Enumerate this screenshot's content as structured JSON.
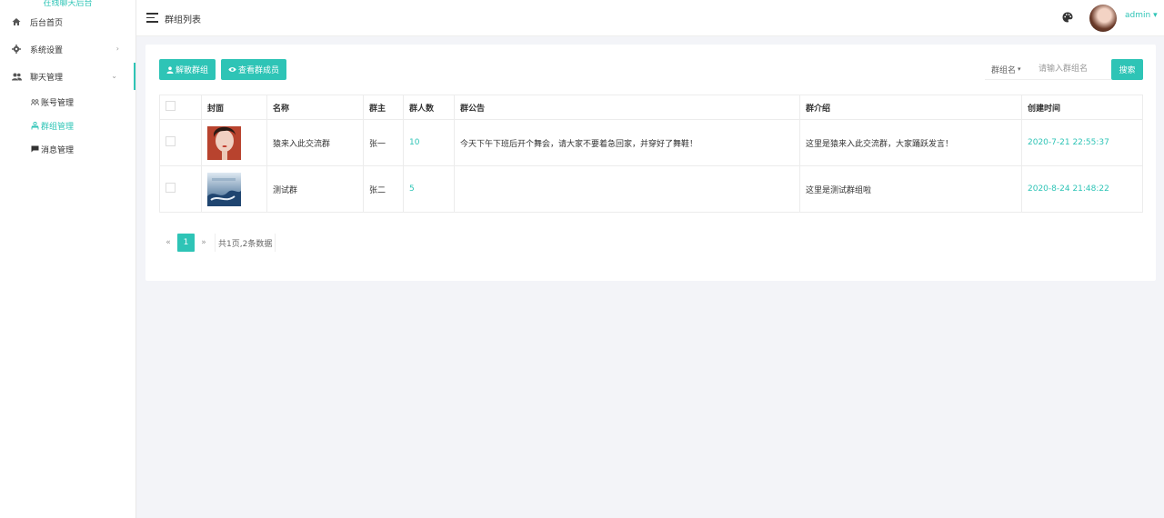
{
  "app": {
    "brand": "在线聊天后台"
  },
  "sidebar": {
    "items": [
      {
        "label": "后台首页",
        "icon": "home-icon"
      },
      {
        "label": "系统设置",
        "icon": "gear-icon",
        "arrow": "›"
      },
      {
        "label": "聊天管理",
        "icon": "users-icon",
        "arrow": "⌄"
      }
    ],
    "sub_items": [
      {
        "label": "账号管理",
        "icon": "people-icon"
      },
      {
        "label": "群组管理",
        "icon": "group-icon"
      },
      {
        "label": "消息管理",
        "icon": "message-icon"
      }
    ]
  },
  "header": {
    "title": "群组列表",
    "username": "admin",
    "user_caret": "▾"
  },
  "toolbar": {
    "dissolve_label": "解散群组",
    "view_members_label": "查看群成员"
  },
  "search": {
    "field_label": "群组名",
    "field_caret": "▾",
    "placeholder": "请输入群组名",
    "value": "",
    "button_label": "搜索"
  },
  "table": {
    "headers": [
      "",
      "封面",
      "名称",
      "群主",
      "群人数",
      "群公告",
      "群介绍",
      "创建时间"
    ],
    "rows": [
      {
        "name": "猿来入此交流群",
        "owner": "张一",
        "count": "10",
        "notice": "今天下午下班后开个舞会，请大家不要着急回家，并穿好了舞鞋！",
        "intro": "这里是猿来入此交流群，大家踊跃发言！",
        "created": "2020-7-21 22:55:37"
      },
      {
        "name": "测试群",
        "owner": "张二",
        "count": "5",
        "notice": "",
        "intro": "这里是测试群组啦",
        "created": "2020-8-24 21:48:22"
      }
    ]
  },
  "pagination": {
    "prev": "«",
    "current": "1",
    "next": "»",
    "info": "共1页,2条数据"
  },
  "colors": {
    "accent": "#2ec4b6",
    "background": "#f3f4f8"
  }
}
